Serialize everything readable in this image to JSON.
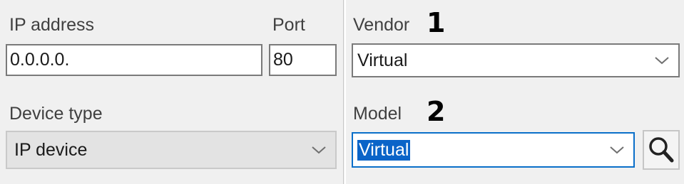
{
  "connection": {
    "ip_label": "IP address",
    "ip_value": "0.0.0.0.",
    "port_label": "Port",
    "port_value": "80"
  },
  "device_type": {
    "label": "Device type",
    "value": "IP device"
  },
  "vendor": {
    "label": "Vendor",
    "value": "Virtual",
    "callout": "1"
  },
  "model": {
    "label": "Model",
    "value": "Virtual",
    "callout": "2"
  },
  "icons": {
    "dropdown": "chevron-down-icon",
    "search": "search-icon"
  },
  "colors": {
    "background": "#f0f0f0",
    "selection": "#0a64c8",
    "focus_border": "#0a6fc9"
  }
}
